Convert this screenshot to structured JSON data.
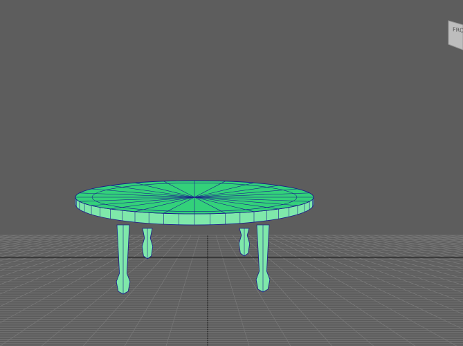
{
  "viewport": {
    "background": "#5d5d5d",
    "grid_color": "#777777",
    "grid_axis_color": "#2e2e2e"
  },
  "view_cube": {
    "label": "FRO"
  },
  "object": {
    "name_icon": "table-mesh",
    "top_color": "#33d17a",
    "side_color": "#7fe8aa",
    "wire_color": "#1a1a8c"
  }
}
